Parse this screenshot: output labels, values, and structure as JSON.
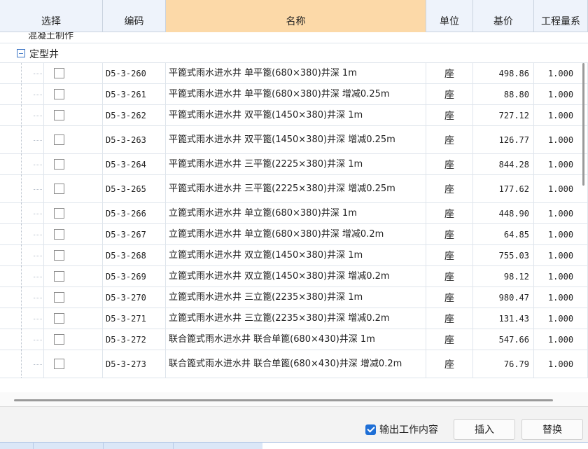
{
  "columns": {
    "select": "选择",
    "code": "编码",
    "name": "名称",
    "unit": "单位",
    "price": "基价",
    "coef": "工程量系"
  },
  "partial_row_text": "混凝土制作",
  "group": {
    "label": "定型井"
  },
  "rows": [
    {
      "code": "D5-3-260",
      "name": "平篦式雨水进水井 单平篦(680×380)井深 1m",
      "unit": "座",
      "price": "498.86",
      "coef": "1.000"
    },
    {
      "code": "D5-3-261",
      "name": "平篦式雨水进水井 单平篦(680×380)井深 增减0.25m",
      "unit": "座",
      "price": "88.80",
      "coef": "1.000"
    },
    {
      "code": "D5-3-262",
      "name": "平篦式雨水进水井 双平篦(1450×380)井深 1m",
      "unit": "座",
      "price": "727.12",
      "coef": "1.000"
    },
    {
      "code": "D5-3-263",
      "name": "平篦式雨水进水井 双平篦(1450×380)井深 增减0.25m",
      "unit": "座",
      "price": "126.77",
      "coef": "1.000"
    },
    {
      "code": "D5-3-264",
      "name": "平篦式雨水进水井 三平篦(2225×380)井深 1m",
      "unit": "座",
      "price": "844.28",
      "coef": "1.000"
    },
    {
      "code": "D5-3-265",
      "name": "平篦式雨水进水井 三平篦(2225×380)井深 增减0.25m",
      "unit": "座",
      "price": "177.62",
      "coef": "1.000"
    },
    {
      "code": "D5-3-266",
      "name": "立篦式雨水进水井 单立篦(680×380)井深 1m",
      "unit": "座",
      "price": "448.90",
      "coef": "1.000"
    },
    {
      "code": "D5-3-267",
      "name": "立篦式雨水进水井 单立篦(680×380)井深 增减0.2m",
      "unit": "座",
      "price": "64.85",
      "coef": "1.000"
    },
    {
      "code": "D5-3-268",
      "name": "立篦式雨水进水井 双立篦(1450×380)井深 1m",
      "unit": "座",
      "price": "755.03",
      "coef": "1.000"
    },
    {
      "code": "D5-3-269",
      "name": "立篦式雨水进水井 双立篦(1450×380)井深 增减0.2m",
      "unit": "座",
      "price": "98.12",
      "coef": "1.000"
    },
    {
      "code": "D5-3-270",
      "name": "立篦式雨水进水井 三立篦(2235×380)井深 1m",
      "unit": "座",
      "price": "980.47",
      "coef": "1.000"
    },
    {
      "code": "D5-3-271",
      "name": "立篦式雨水进水井 三立篦(2235×380)井深 增减0.2m",
      "unit": "座",
      "price": "131.43",
      "coef": "1.000"
    },
    {
      "code": "D5-3-272",
      "name": "联合篦式雨水进水井 联合单篦(680×430)井深 1m",
      "unit": "座",
      "price": "547.66",
      "coef": "1.000"
    },
    {
      "code": "D5-3-273",
      "name": "联合篦式雨水进水井 联合单篦(680×430)井深 增减0.2m",
      "unit": "座",
      "price": "76.79",
      "coef": "1.000"
    }
  ],
  "footer": {
    "output_work_content": "输出工作内容",
    "insert": "插入",
    "replace": "替换"
  }
}
